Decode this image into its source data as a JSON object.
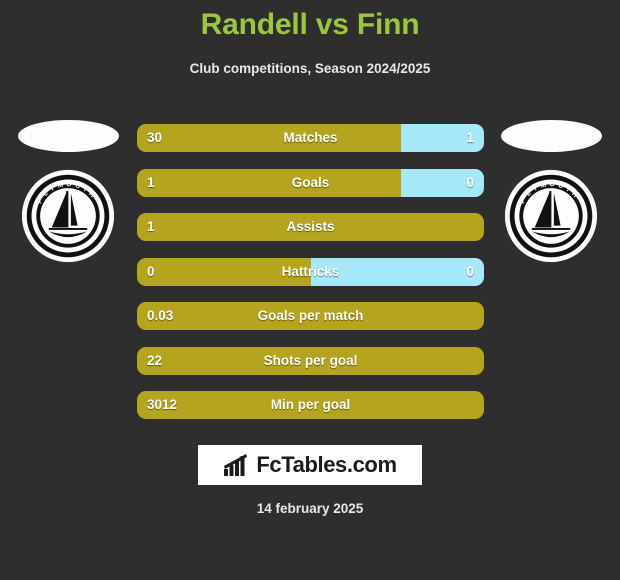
{
  "header": {
    "title": "Randell vs Finn",
    "subtitle": "Club competitions, Season 2024/2025",
    "title_color": "#9ac73c"
  },
  "colors": {
    "background": "#2e2e2e",
    "bar_left": "#b5a41d",
    "bar_right": "#a5e8fa",
    "text": "#ffffff"
  },
  "left_player": {
    "photo": "player-photo-placeholder",
    "crest": "plymouth-club-crest",
    "crest_text": "PLYMOUTH"
  },
  "right_player": {
    "photo": "player-photo-placeholder",
    "crest": "plymouth-club-crest",
    "crest_text": "PLYMOUTH"
  },
  "stats": [
    {
      "label": "Matches",
      "left": "30",
      "right": "1",
      "left_pct": 76,
      "has_right": true
    },
    {
      "label": "Goals",
      "left": "1",
      "right": "0",
      "left_pct": 76,
      "has_right": true
    },
    {
      "label": "Assists",
      "left": "1",
      "right": "",
      "left_pct": 100,
      "has_right": false
    },
    {
      "label": "Hattricks",
      "left": "0",
      "right": "0",
      "left_pct": 50,
      "has_right": true
    },
    {
      "label": "Goals per match",
      "left": "0.03",
      "right": "",
      "left_pct": 100,
      "has_right": false
    },
    {
      "label": "Shots per goal",
      "left": "22",
      "right": "",
      "left_pct": 100,
      "has_right": false
    },
    {
      "label": "Min per goal",
      "left": "3012",
      "right": "",
      "left_pct": 100,
      "has_right": false
    }
  ],
  "footer": {
    "brand": "FcTables.com",
    "brand_icon": "bar-chart-icon",
    "date": "14 february 2025"
  }
}
